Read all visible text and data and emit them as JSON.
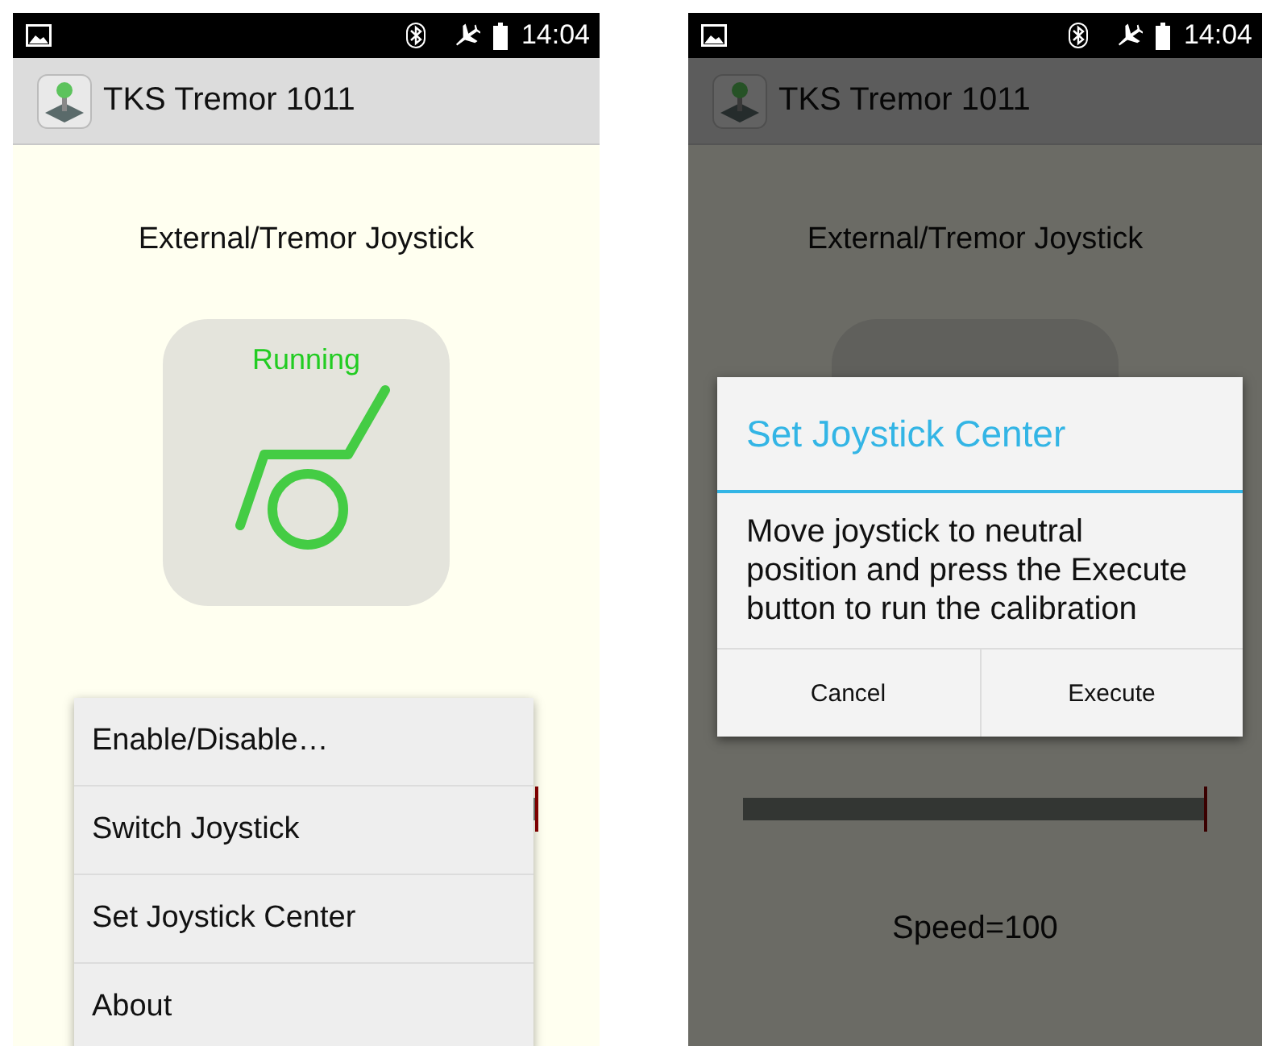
{
  "screens": [
    {
      "status_bar": {
        "time": "14:04"
      },
      "app_bar": {
        "title": "TKS Tremor 1011"
      },
      "heading": "External/Tremor Joystick",
      "status_tile": {
        "label": "Running"
      },
      "speed_slider": {
        "level": 1.0
      },
      "menu": [
        {
          "label": "Enable/Disable…"
        },
        {
          "label": "Switch Joystick"
        },
        {
          "label": "Set Joystick Center"
        },
        {
          "label": "About"
        }
      ]
    },
    {
      "status_bar": {
        "time": "14:04"
      },
      "app_bar": {
        "title": "TKS Tremor 1011"
      },
      "heading": "External/Tremor Joystick",
      "speed_slider": {
        "level": 1.0
      },
      "speed_reading": "Speed=100",
      "dialog": {
        "title": "Set Joystick Center",
        "message": "Move joystick to neutral position and press the Execute button to run the calibration",
        "buttons": [
          "Cancel",
          "Execute"
        ]
      }
    }
  ]
}
